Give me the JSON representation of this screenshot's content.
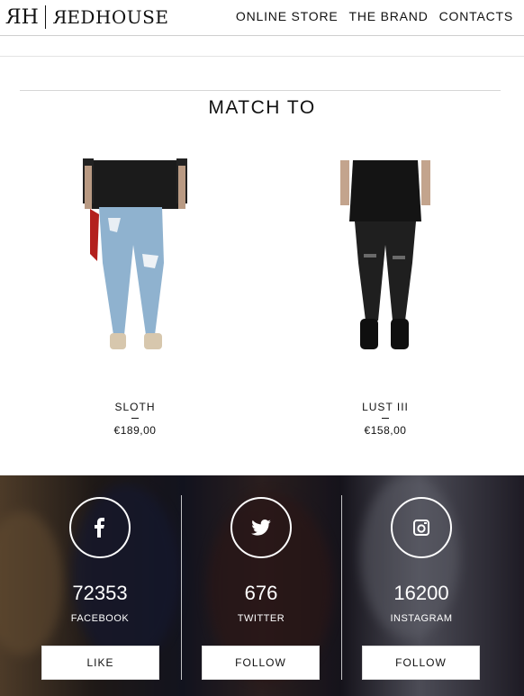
{
  "header": {
    "logo_mark": "RH",
    "logo_word": "REDHOUSE",
    "nav": [
      "ONLINE STORE",
      "THE BRAND",
      "CONTACTS"
    ]
  },
  "section": {
    "title": "MATCH TO"
  },
  "products": [
    {
      "name": "SLOTH",
      "price": "€189,00"
    },
    {
      "name": "LUST III",
      "price": "€158,00"
    }
  ],
  "social": [
    {
      "icon": "facebook-icon",
      "count": "72353",
      "label": "FACEBOOK",
      "button": "LIKE"
    },
    {
      "icon": "twitter-icon",
      "count": "676",
      "label": "TWITTER",
      "button": "FOLLOW"
    },
    {
      "icon": "instagram-icon",
      "count": "16200",
      "label": "INSTAGRAM",
      "button": "FOLLOW"
    }
  ]
}
